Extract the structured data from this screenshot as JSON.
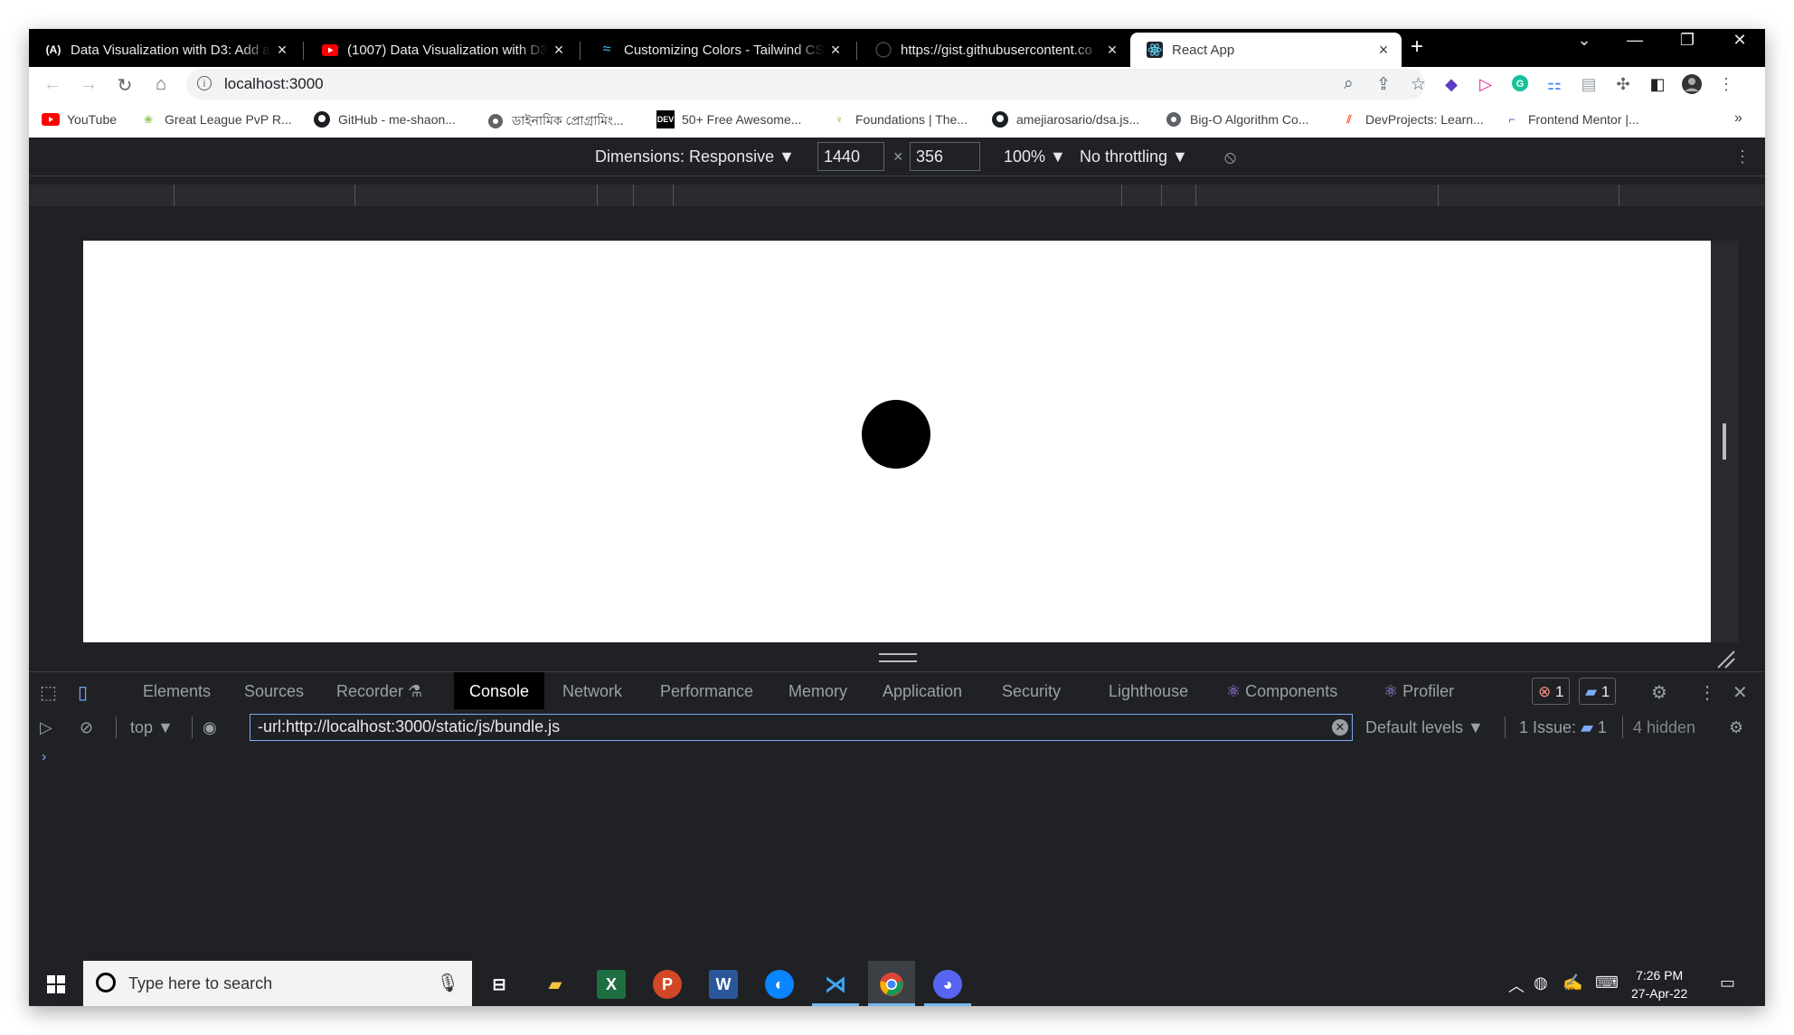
{
  "browser": {
    "tabs": [
      {
        "title": "Data Visualization with D3: Add a",
        "icon": "a-icon",
        "active": false
      },
      {
        "title": "(1007) Data Visualization with D3",
        "icon": "youtube-icon",
        "active": false
      },
      {
        "title": "Customizing Colors - Tailwind CS",
        "icon": "tailwind-icon",
        "active": false
      },
      {
        "title": "https://gist.githubusercontent.co",
        "icon": "github-icon",
        "active": false
      },
      {
        "title": "React App",
        "icon": "react-icon",
        "active": true
      }
    ],
    "new_tab": "+",
    "window_controls": {
      "dropdown": "⌄",
      "minimize": "—",
      "restore": "❐",
      "close": "✕"
    },
    "address": "localhost:3000",
    "bookmarks": [
      {
        "label": "YouTube",
        "icon": "youtube-icon"
      },
      {
        "label": "Great League PvP R...",
        "icon": "pokemon-icon"
      },
      {
        "label": "GitHub - me-shaon...",
        "icon": "github-icon"
      },
      {
        "label": "ডাইনামিক প্রোগ্রামিং...",
        "icon": "globe-icon"
      },
      {
        "label": "50+ Free Awesome...",
        "icon": "dev-icon"
      },
      {
        "label": "Foundations | The...",
        "icon": "trophy-icon"
      },
      {
        "label": "amejiarosario/dsa.js...",
        "icon": "github-icon"
      },
      {
        "label": "Big-O Algorithm Co...",
        "icon": "globe-icon"
      },
      {
        "label": "DevProjects: Learn...",
        "icon": "devprojects-icon"
      },
      {
        "label": "Frontend Mentor |...",
        "icon": "frontendmentor-icon"
      }
    ],
    "bookmarks_more": "»"
  },
  "device_toolbar": {
    "dimensions_label": "Dimensions: Responsive ▼",
    "width": "1440",
    "times": "×",
    "height": "356",
    "zoom": "100% ▼",
    "throttling": "No throttling ▼"
  },
  "devtools": {
    "tabs": [
      {
        "label": "Elements"
      },
      {
        "label": "Sources"
      },
      {
        "label": "Recorder"
      },
      {
        "label": "Console"
      },
      {
        "label": "Network"
      },
      {
        "label": "Performance"
      },
      {
        "label": "Memory"
      },
      {
        "label": "Application"
      },
      {
        "label": "Security"
      },
      {
        "label": "Lighthouse"
      },
      {
        "label": "Components"
      },
      {
        "label": "Profiler"
      }
    ],
    "active_tab": "Console",
    "error_count": "1",
    "message_count": "1",
    "console": {
      "context": "top ▼",
      "filter": "-url:http://localhost:3000/static/js/bundle.js",
      "levels": "Default levels ▼",
      "issues_label": "1 Issue:",
      "issues_count": "1",
      "hidden": "4 hidden",
      "prompt": "›"
    }
  },
  "taskbar": {
    "search_placeholder": "Type here to search",
    "time": "7:26 PM",
    "date": "27-Apr-22"
  },
  "colors": {
    "accent_blue": "#1a73e8",
    "devtools_bg": "#202124",
    "error_red": "#f28b82"
  }
}
